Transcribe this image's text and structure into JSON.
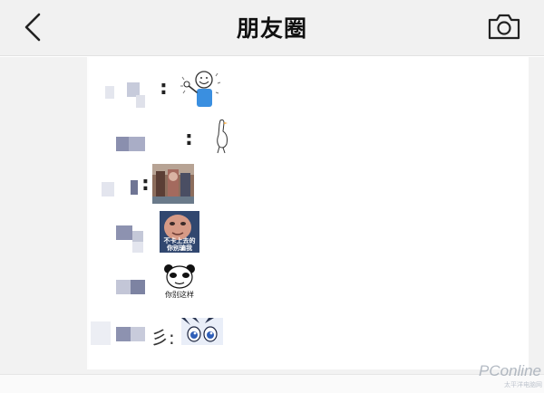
{
  "navbar": {
    "title": "朋友圈",
    "back_icon": "chevron-left-icon",
    "camera_icon": "camera-icon"
  },
  "rows": [
    {
      "separator": ":",
      "sticker": "smiley-thumbs-up-sticker"
    },
    {
      "separator": ":",
      "sticker": "goose-sticker"
    },
    {
      "separator": ":",
      "sticker": "photo-thumbnail"
    },
    {
      "sticker": "child-meme-sticker",
      "sticker_caption_lines": [
        "不卡上去的",
        "你别骗我"
      ]
    },
    {
      "sticker": "panda-face-meme-sticker",
      "sticker_caption": "你别这样"
    },
    {
      "name_fragment": "彡:",
      "sticker": "anime-eyes-sticker"
    }
  ],
  "watermark": {
    "brand": "PConline",
    "sub": "太平洋电脑网"
  },
  "colors": {
    "navbar_bg": "#f1f1f1",
    "content_bg": "#f2f2f2",
    "panel_bg": "#ffffff",
    "mosaic_dark": "#7c82a4",
    "mosaic_light": "#c9ccdc"
  }
}
